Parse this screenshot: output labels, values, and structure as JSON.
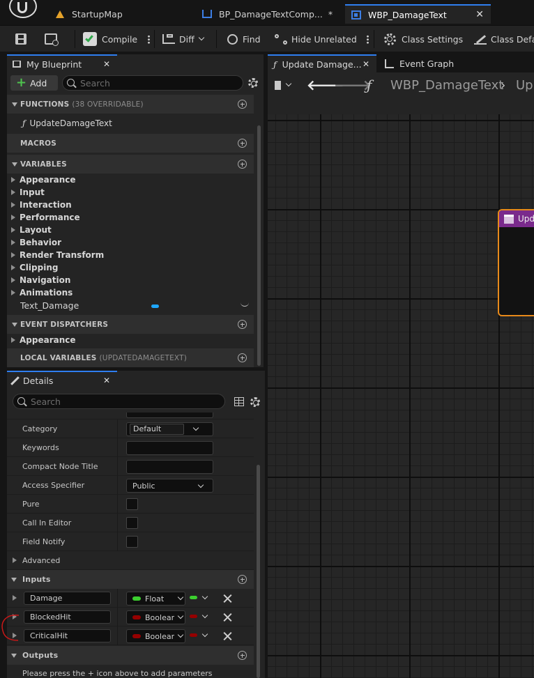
{
  "tabs": [
    {
      "label": "StartupMap"
    },
    {
      "label": "BP_DamageTextComp...",
      "modified": "*"
    },
    {
      "label": "WBP_DamageText"
    }
  ],
  "toolbar": {
    "compile": "Compile",
    "diff": "Diff",
    "find": "Find",
    "hide_unrelated": "Hide Unrelated",
    "class_settings": "Class Settings",
    "class_defaults": "Class Defa"
  },
  "my_blueprint": {
    "title": "My Blueprint",
    "add_label": "Add",
    "search_placeholder": "Search",
    "functions_label": "FUNCTIONS",
    "functions_sub": "(38 OVERRIDABLE)",
    "function_item": "UpdateDamageText",
    "macros_label": "MACROS",
    "variables_label": "VARIABLES",
    "variable_categories": [
      "Appearance",
      "Input",
      "Interaction",
      "Performance",
      "Layout",
      "Behavior",
      "Render Transform",
      "Clipping",
      "Navigation",
      "Animations"
    ],
    "variable_item": "Text_Damage",
    "variable_color": "#1ea7ff",
    "dispatchers_label": "EVENT DISPATCHERS",
    "dispatcher_category": "Appearance",
    "local_vars_label": "LOCAL VARIABLES",
    "local_vars_sub": "(UPDATEDAMAGETEXT)"
  },
  "details": {
    "title": "Details",
    "search_placeholder": "Search",
    "category_label": "Category",
    "category_value": "Default",
    "keywords_label": "Keywords",
    "compact_label": "Compact Node Title",
    "access_label": "Access Specifier",
    "access_value": "Public",
    "pure_label": "Pure",
    "call_in_editor_label": "Call In Editor",
    "field_notify_label": "Field Notify",
    "advanced_label": "Advanced",
    "inputs_label": "Inputs",
    "inputs": [
      {
        "name": "Damage",
        "type": "Float",
        "color": "#3ccf2f"
      },
      {
        "name": "BlockedHit",
        "type": "Boolean",
        "color": "#950000"
      },
      {
        "name": "CriticalHit",
        "type": "Boolean",
        "color": "#950000"
      }
    ],
    "outputs_label": "Outputs",
    "outputs_hint": "Please press the + icon above to add parameters"
  },
  "graph": {
    "tab_function": "Update Damage...",
    "tab_event": "Event Graph",
    "breadcrumb_root": "WBP_DamageText",
    "breadcrumb_current": "Up",
    "node_title": "Upd",
    "node_color": "#7a2a8c",
    "node_outline": "#e88a1a"
  }
}
